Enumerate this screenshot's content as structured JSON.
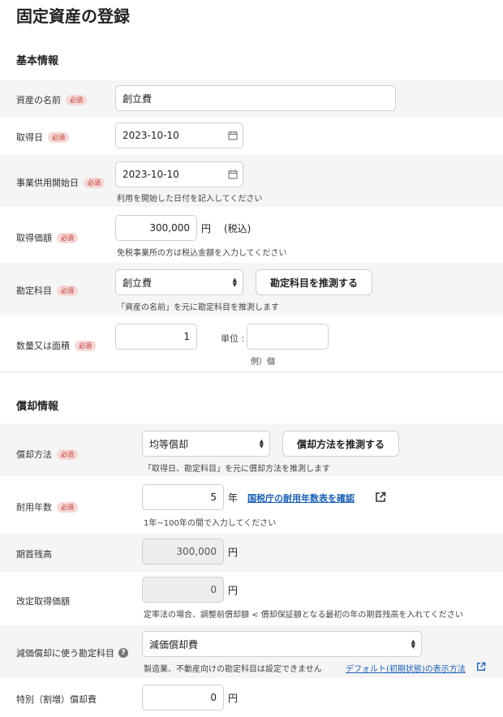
{
  "page": {
    "title": "固定資産の登録"
  },
  "required_label": "必須",
  "basic": {
    "section_title": "基本情報",
    "name": {
      "label": "資産の名前",
      "value": "創立費"
    },
    "acquired_date": {
      "label": "取得日",
      "value": "2023-10-10"
    },
    "start_date": {
      "label": "事業供用開始日",
      "value": "2023-10-10",
      "hint": "利用を開始した日付を記入してください"
    },
    "price": {
      "label": "取得価額",
      "value": "300,000",
      "unit": "円",
      "tax": "(税込)",
      "hint": "免税事業所の方は税込金額を入力してください"
    },
    "account": {
      "label": "勘定科目",
      "value": "創立費",
      "button": "勘定科目を推測する",
      "hint": "「資産の名前」を元に勘定科目を推測します"
    },
    "quantity": {
      "label": "数量又は面積",
      "value": "1",
      "unit_label": "単位 :",
      "unit_value": "",
      "unit_hint": "例）個"
    }
  },
  "depreciation": {
    "section_title": "償却情報",
    "method": {
      "label": "償却方法",
      "value": "均等償却",
      "button": "償却方法を推測する",
      "hint": "「取得日、勘定科目」を元に償却方法を推測します"
    },
    "useful_life": {
      "label": "耐用年数",
      "value": "5",
      "unit": "年",
      "link": "国税庁の耐用年数表を確認",
      "hint": "1年~100年の間で入力してください"
    },
    "opening_balance": {
      "label": "期首残高",
      "value": "300,000",
      "unit": "円"
    },
    "revised_price": {
      "label": "改定取得価額",
      "value": "0",
      "unit": "円",
      "hint": "定率法の場合、調整前償却額 < 償却保証額となる最初の年の期首残高を入れてください"
    },
    "depr_account": {
      "label": "減価償却に使う勘定科目",
      "value": "減価償却費",
      "hint": "製造業、不動産向けの勘定科目は設定できません",
      "link": "デフォルト(初期状態)の表示方法"
    },
    "special": {
      "label": "特別（割増）償却費",
      "value": "0",
      "unit": "円"
    }
  }
}
